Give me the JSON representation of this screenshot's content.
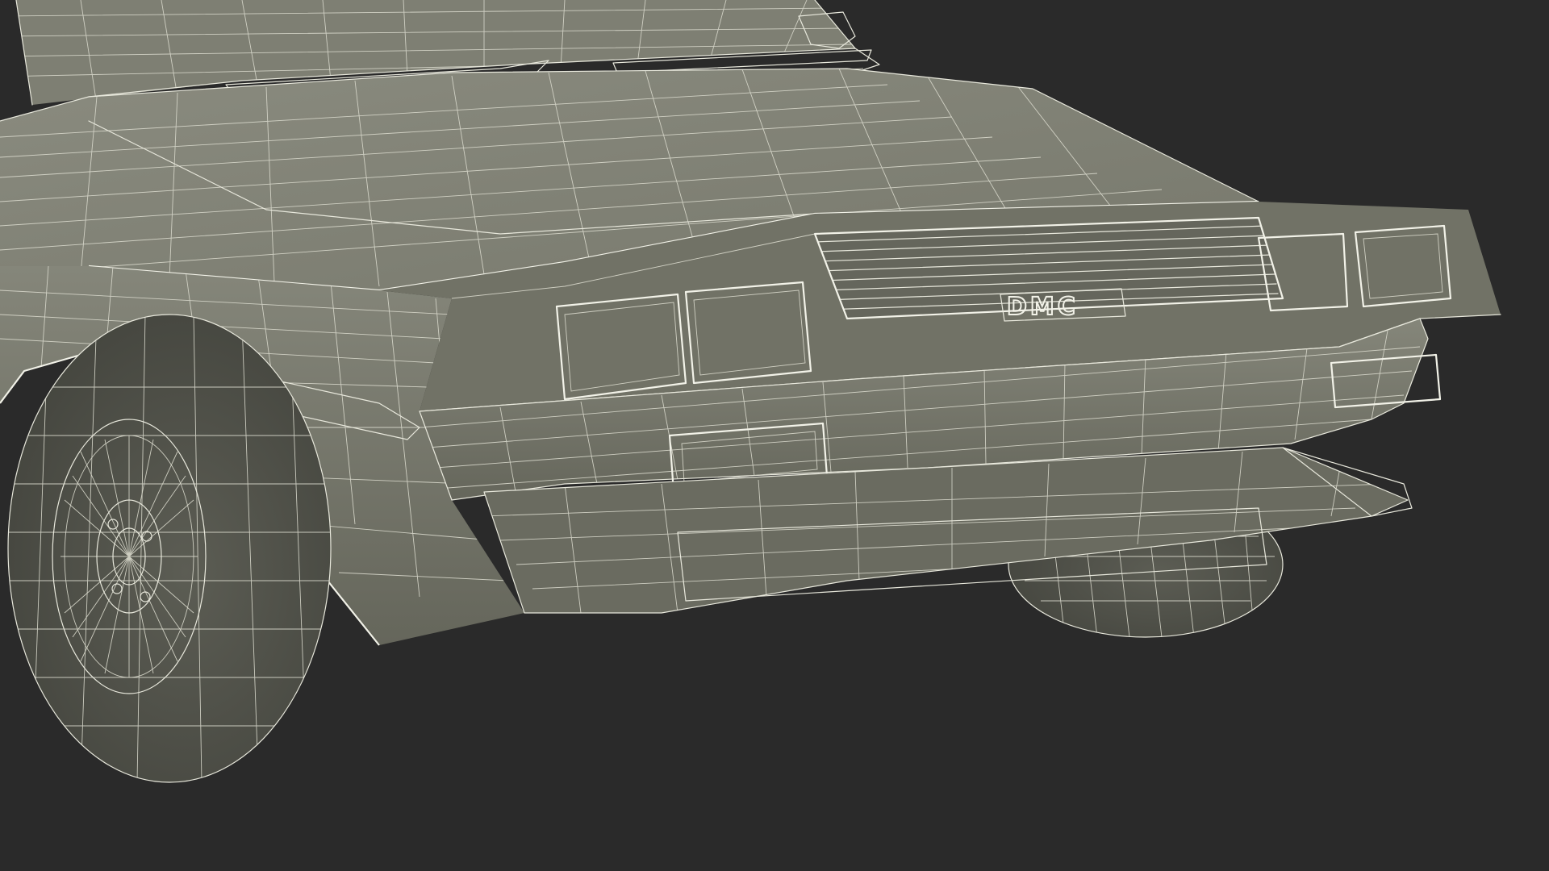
{
  "scene": {
    "background_color": "#2a2a2a",
    "surface_color": "#7a7b6e",
    "surface_shadow_color": "#5d5e54",
    "surface_dark_color": "#4d4e46",
    "wire_color": "#e8e8dc",
    "lamp_color": "#5f6058",
    "badge_text": "DMC"
  }
}
